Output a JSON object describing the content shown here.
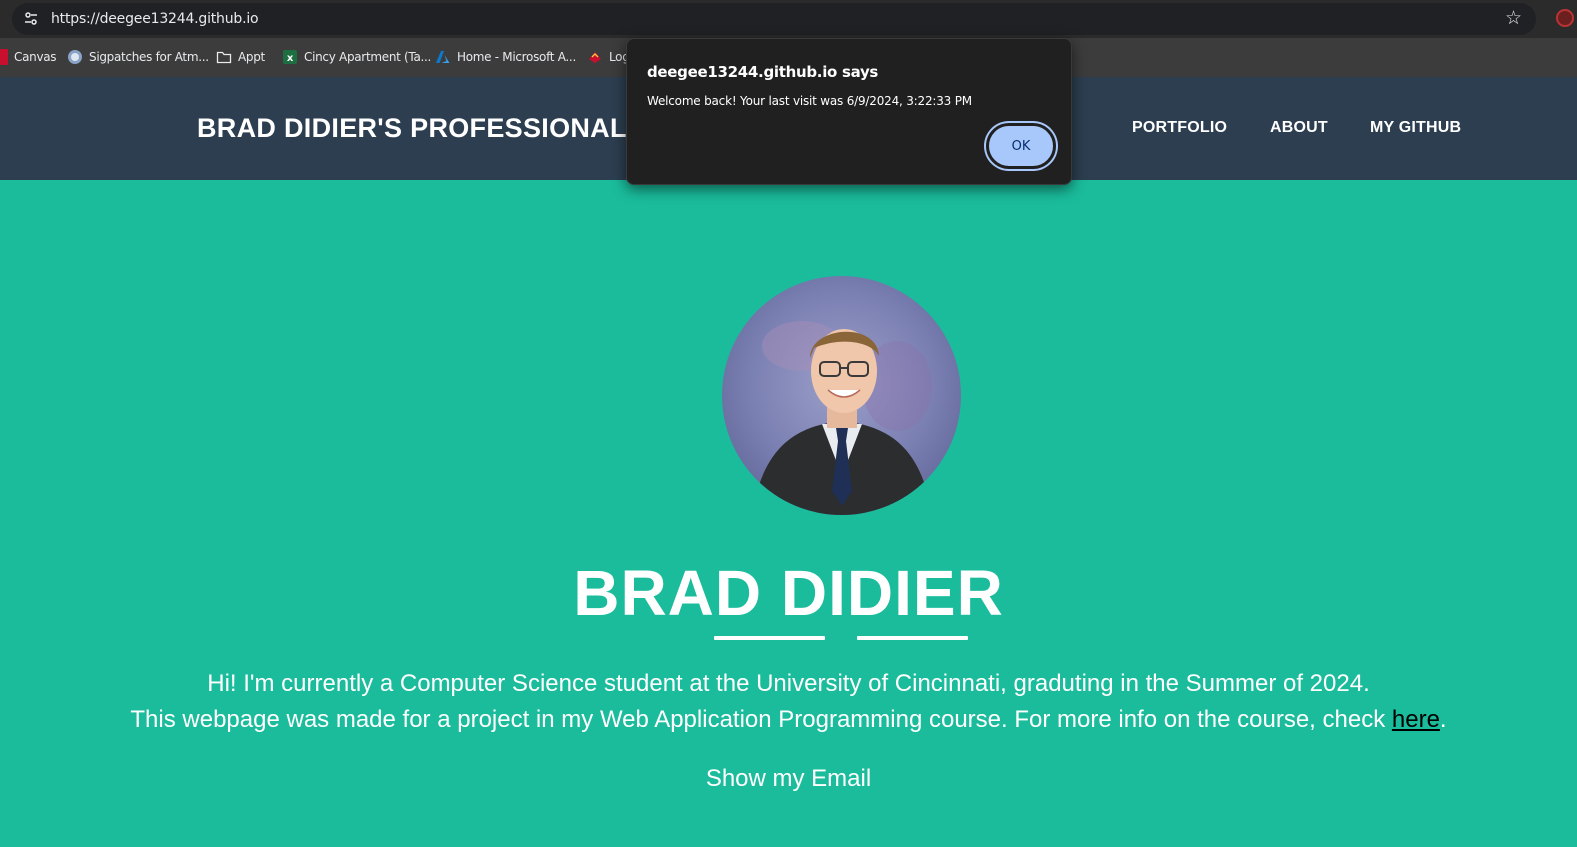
{
  "browser": {
    "url": "https://deegee13244.github.io",
    "icons": {
      "site_info": "tune-icon",
      "bookmark_star": "star-icon",
      "extension": "extension-icon"
    },
    "bookmarks": [
      {
        "label": "Canvas",
        "icon": "canvas-icon"
      },
      {
        "label": "Sigpatches for Atm...",
        "icon": "site-icon"
      },
      {
        "label": "Appt",
        "icon": "folder-icon"
      },
      {
        "label": "Cincy Apartment (Ta...",
        "icon": "excel-icon"
      },
      {
        "label": "Home - Microsoft A...",
        "icon": "azure-icon"
      },
      {
        "label": "Log",
        "icon": "log-icon"
      }
    ]
  },
  "nav": {
    "brand": "BRAD DIDIER'S PROFESSIONAL",
    "links": [
      "PORTFOLIO",
      "ABOUT",
      "MY GITHUB"
    ]
  },
  "masthead": {
    "avatar": "profile-photo",
    "title": "BRAD DIDIER",
    "intro_line1": "Hi! I'm currently a Computer Science student at the University of Cincinnati, graduting in the Summer of 2024.",
    "intro_line2_text": "This webpage was made for a project in my Web Application Programming course. For more info on the course, check ",
    "intro_link": "here",
    "intro_line2_end": ".",
    "email_button": "Show my Email"
  },
  "dialog": {
    "title": "deegee13244.github.io says",
    "message": "Welcome back! Your last visit was 6/9/2024, 3:22:33 PM",
    "ok_label": "OK"
  },
  "colors": {
    "nav_bg": "#2c3e50",
    "masthead_bg": "#1abc9c",
    "dialog_bg": "#202020",
    "ok_button": "#a8c7fa"
  }
}
